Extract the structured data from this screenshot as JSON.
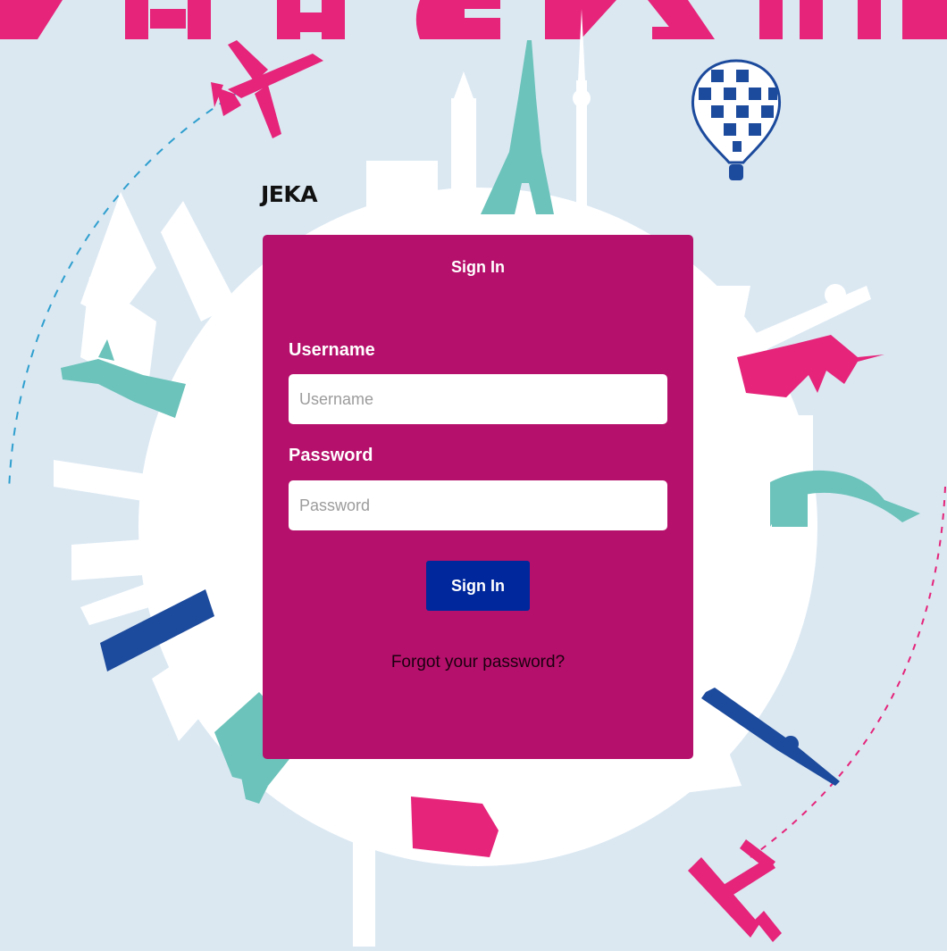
{
  "brand": {
    "name": "JEKA"
  },
  "signin": {
    "title": "Sign In",
    "username_label": "Username",
    "username_placeholder": "Username",
    "username_value": "",
    "password_label": "Password",
    "password_placeholder": "Password",
    "password_value": "",
    "submit_label": "Sign In",
    "forgot_link": "Forgot your password?"
  },
  "background": {
    "illustration": "world-landmarks-globe",
    "elements": [
      "airplane-icon",
      "hot-air-balloon-icon",
      "eiffel-tower-icon",
      "statue-of-liberty-icon",
      "tv-tower-icon",
      "big-ben-icon",
      "bridge-icon",
      "propeller-plane-icon"
    ]
  },
  "colors": {
    "page_bg": "#dbe8f2",
    "card": "#b5106b",
    "button": "#00279c",
    "accent_pink": "#e5247a",
    "accent_teal": "#6cc3bb",
    "accent_navy": "#1c4a9c"
  }
}
